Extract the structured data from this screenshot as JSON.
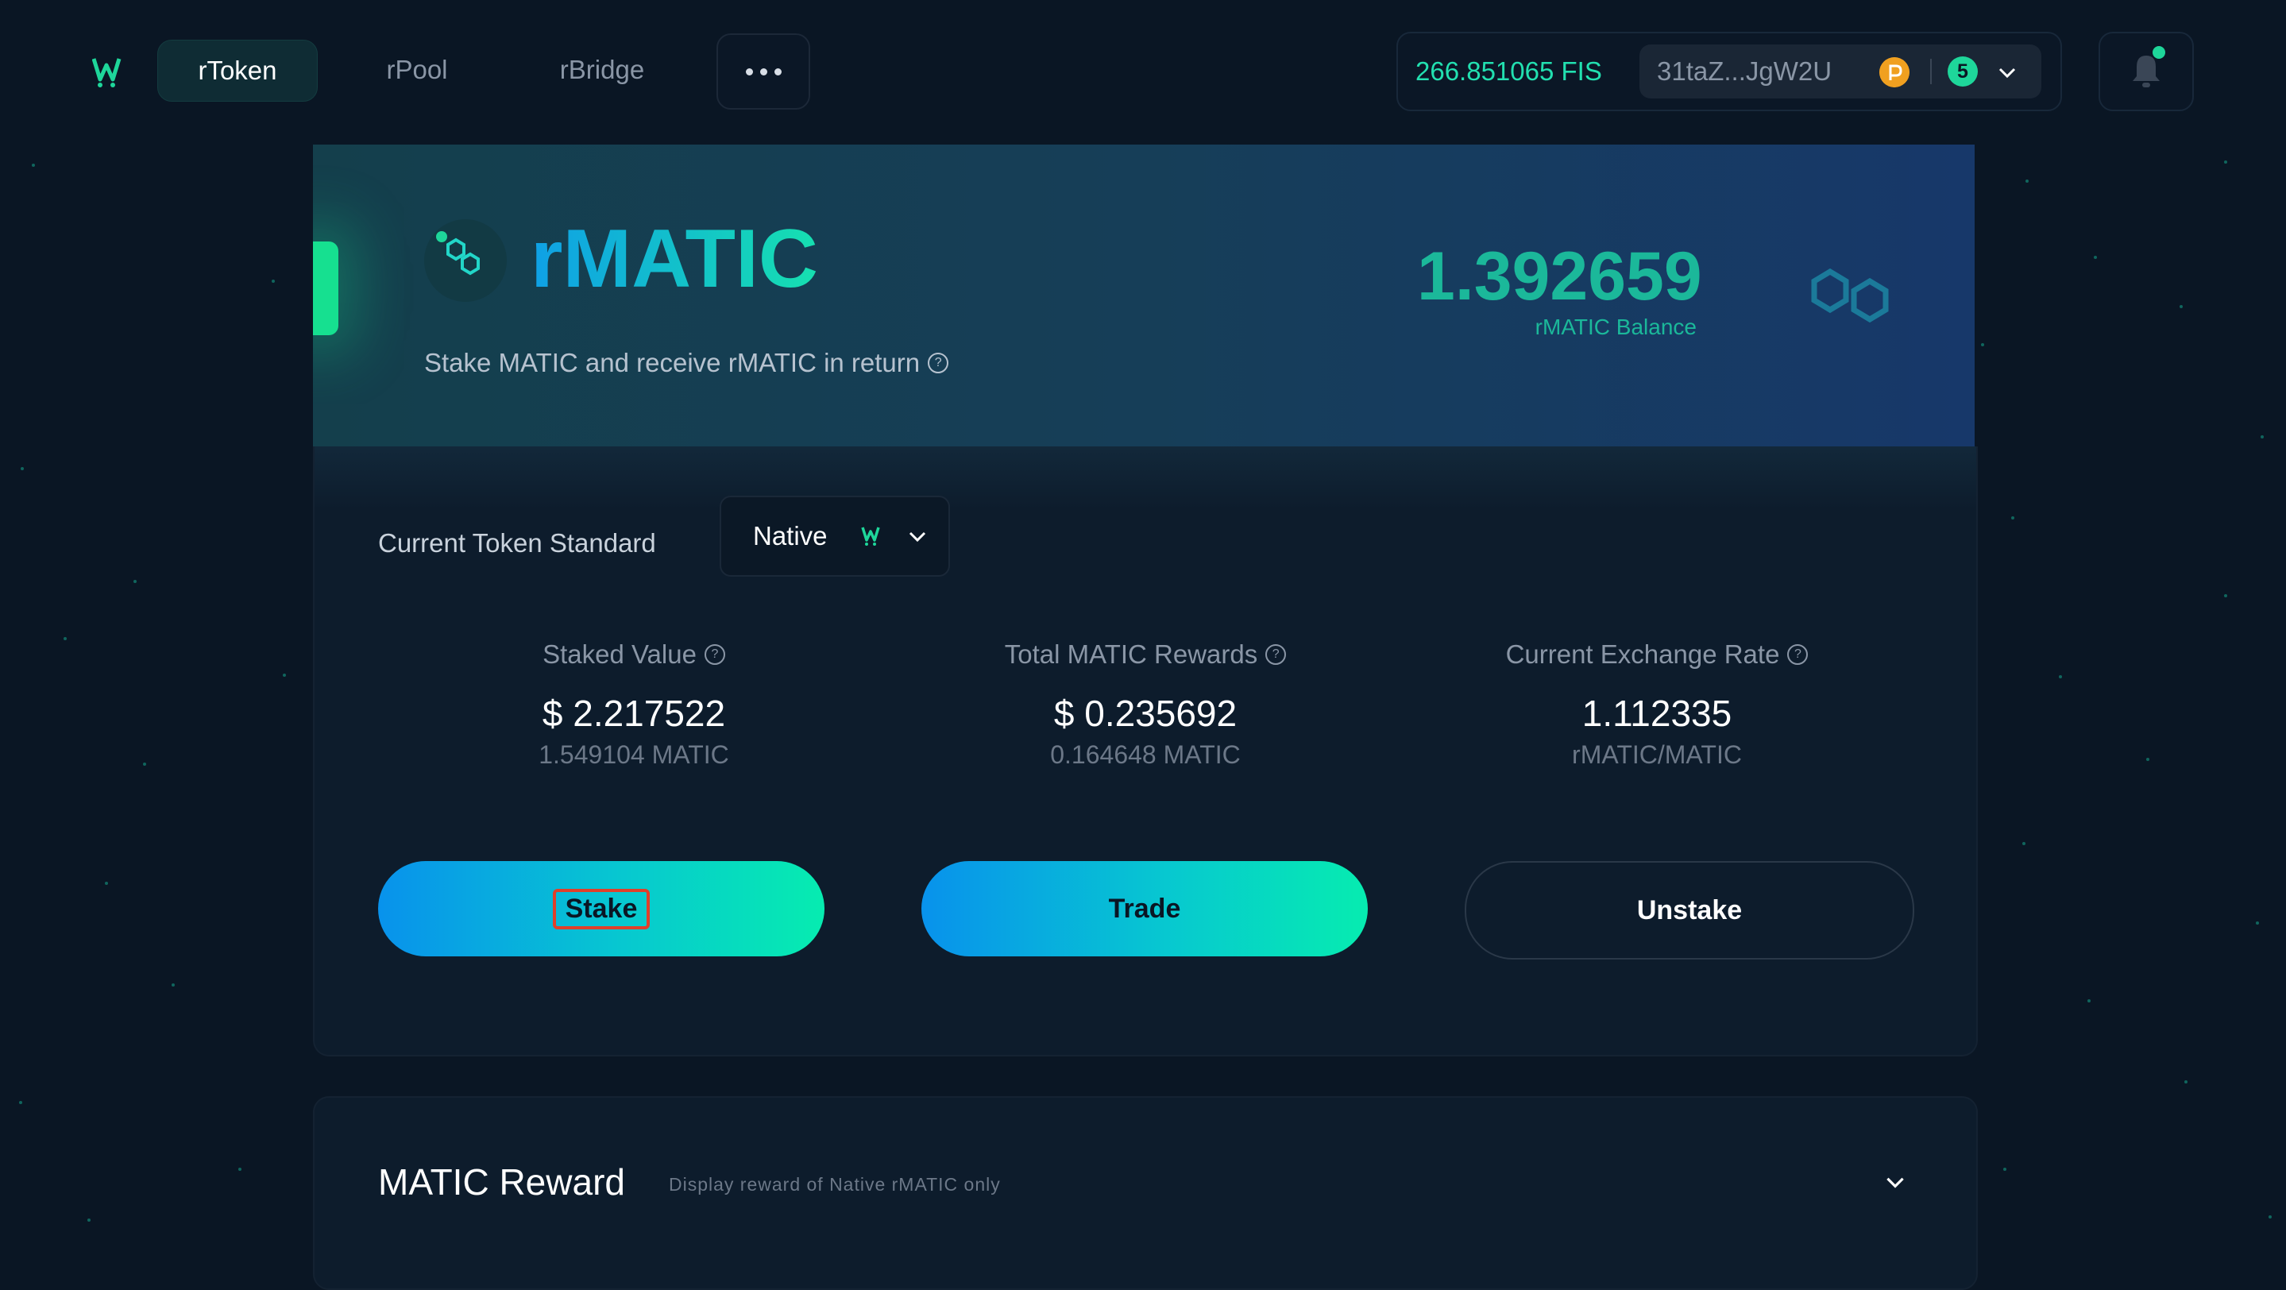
{
  "nav": {
    "tabs": [
      {
        "label": "rToken",
        "active": true
      },
      {
        "label": "rPool",
        "active": false
      },
      {
        "label": "rBridge",
        "active": false
      }
    ],
    "more_icon": "ellipsis-icon"
  },
  "wallet": {
    "fis_balance": "266.851065 FIS",
    "address": "31taZ...JgW2U",
    "network_count": "5"
  },
  "hero": {
    "token_name": "rMATIC",
    "description": "Stake MATIC and receive rMATIC in return",
    "balance": "1.392659",
    "balance_label": "rMATIC Balance"
  },
  "token_standard": {
    "label": "Current Token Standard",
    "selected": "Native"
  },
  "stats": [
    {
      "label": "Staked Value",
      "value": "$ 2.217522",
      "sub": "1.549104 MATIC"
    },
    {
      "label": "Total MATIC Rewards",
      "value": "$ 0.235692",
      "sub": "0.164648 MATIC"
    },
    {
      "label": "Current Exchange Rate",
      "value": "1.112335",
      "sub": "rMATIC/MATIC"
    }
  ],
  "actions": {
    "stake": "Stake",
    "trade": "Trade",
    "unstake": "Unstake"
  },
  "reward": {
    "title": "MATIC Reward",
    "subtitle": "Display reward of Native rMATIC only"
  },
  "colors": {
    "background": "#0a1624",
    "accent": "#1ed69a",
    "gradient_start": "#0892ec",
    "gradient_end": "#06ecb0"
  }
}
